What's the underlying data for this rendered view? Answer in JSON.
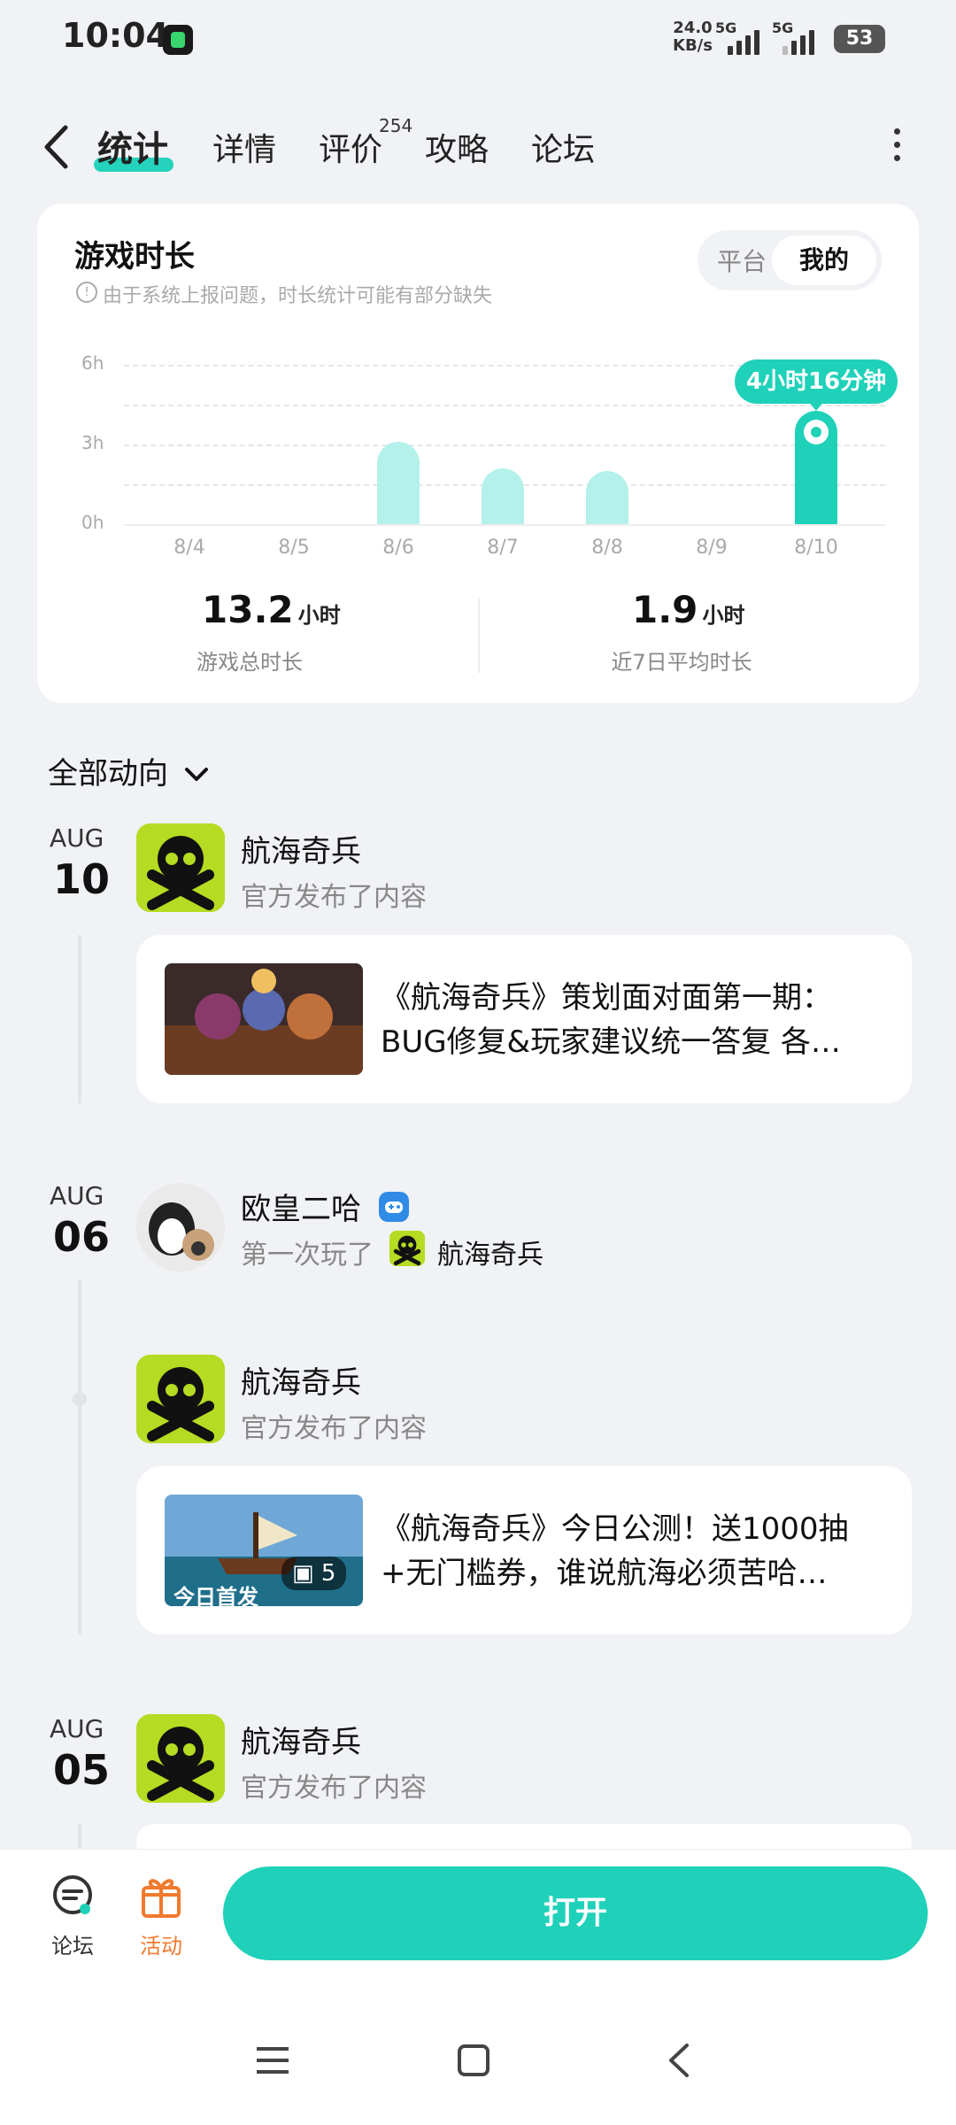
{
  "status_bar": {
    "time": "10:04",
    "net_speed": "24.0",
    "net_unit": "KB/s",
    "sig1_label": "5G",
    "sig2_label": "5G",
    "battery": "53"
  },
  "tabs": {
    "items": [
      "统计",
      "详情",
      "评价",
      "攻略",
      "论坛"
    ],
    "review_count": "254",
    "active": "统计"
  },
  "stats_card": {
    "title": "游戏时长",
    "note": "由于系统上报问题，时长统计可能有部分缺失",
    "toggle": [
      "平台",
      "我的"
    ],
    "selected_toggle": "我的",
    "tooltip": "4小时16分钟",
    "total_value": "13.2",
    "total_unit": "小时",
    "total_label": "游戏总时长",
    "avg_value": "1.9",
    "avg_unit": "小时",
    "avg_label": "近7日平均时长"
  },
  "chart_data": {
    "type": "bar",
    "categories": [
      "8/4",
      "8/5",
      "8/6",
      "8/7",
      "8/8",
      "8/9",
      "8/10"
    ],
    "values": [
      0,
      0,
      3.1,
      2.1,
      2.0,
      0,
      4.27
    ],
    "y_ticks": [
      "0h",
      "3h",
      "6h"
    ],
    "ylim": [
      0,
      6
    ],
    "selected_index": 6,
    "colors": {
      "bar": "#b3f1ea",
      "selected": "#1fd1b9"
    }
  },
  "filter": {
    "label": "全部动向"
  },
  "feed": {
    "group1": {
      "month": "AUG",
      "day": "10",
      "name": "航海奇兵",
      "sub": "官方发布了内容",
      "post": "《航海奇兵》策划面对面第一期：BUG修复&玩家建议统一答复 各…"
    },
    "group2": {
      "month": "AUG",
      "day": "06",
      "user": "欧皇二哈",
      "action": "第一次玩了",
      "game": "航海奇兵",
      "name": "航海奇兵",
      "sub": "官方发布了内容",
      "post": "《航海奇兵》今日公测！送1000抽+无门槛券，谁说航海必须苦哈…",
      "image_count": "5",
      "thumb_text": "今日首发"
    },
    "group3": {
      "month": "AUG",
      "day": "05",
      "name": "航海奇兵",
      "sub": "官方发布了内容"
    }
  },
  "bottom_bar": {
    "forum": "论坛",
    "activity": "活动",
    "open": "打开",
    "activity_color": "#f07a2e",
    "accent": "#1fd1b9"
  }
}
